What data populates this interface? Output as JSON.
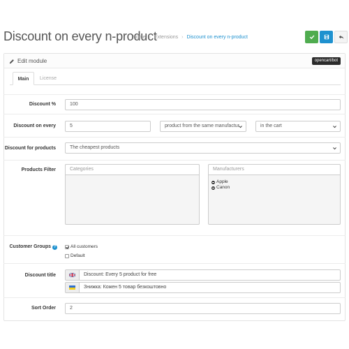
{
  "header": {
    "title": "Discount on every n-product",
    "breadcrumb": [
      "Home",
      "Extensions",
      "Discount on every n-product"
    ],
    "breadcrumb_sep": "›"
  },
  "toolbar": {
    "save_icon": "check-icon",
    "save_stay_icon": "floppy-icon",
    "back_icon": "reply-icon",
    "colors": {
      "save": "#4fac4f",
      "save_stay": "#1e91cf",
      "back": "#f4f4f4"
    }
  },
  "panel": {
    "title": "Edit module",
    "title_icon": "pencil-icon",
    "brand": "opencart/bot"
  },
  "tabs": [
    {
      "label": "Main",
      "active": true
    },
    {
      "label": "License",
      "active": false
    }
  ],
  "form": {
    "discount_percent": {
      "label": "Discount %",
      "value": "100"
    },
    "discount_every": {
      "label": "Discount on every",
      "value": "5",
      "scope_selected": "product from the same manufactur",
      "location_selected": "in the cart"
    },
    "discount_for": {
      "label": "Discount for products",
      "selected": "The cheapest products"
    },
    "products_filter": {
      "label": "Products Filter",
      "categories_placeholder": "Categories",
      "manufacturers_placeholder": "Manufacturers",
      "manufacturers": [
        "Apple",
        "Canon"
      ]
    },
    "customer_groups": {
      "label": "Customer Groups",
      "options": [
        {
          "label": "All customers",
          "checked": true
        },
        {
          "label": "Default",
          "checked": false
        }
      ]
    },
    "discount_title": {
      "label": "Discount title",
      "entries": [
        {
          "lang": "en",
          "flag": "uk-flag-icon",
          "value": "Discount: Every 5 product for free"
        },
        {
          "lang": "uk",
          "flag": "ua-flag-icon",
          "value": "Знижка: Кожен 5 товар безкоштовно"
        }
      ]
    },
    "sort_order": {
      "label": "Sort Order",
      "value": "2"
    }
  },
  "colors": {
    "accent": "#1e91cf",
    "success": "#4fac4f",
    "text": "#333333"
  }
}
